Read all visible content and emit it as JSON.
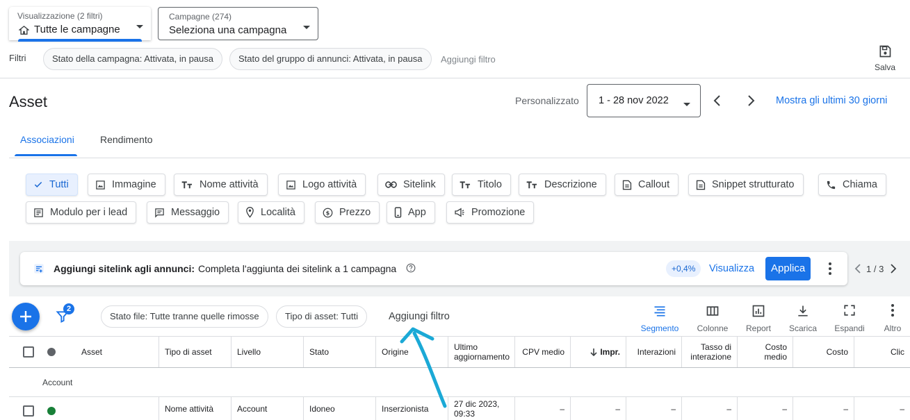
{
  "view_selector": {
    "label": "Visualizzazione (2 filtri)",
    "value": "Tutte le campagne"
  },
  "campaign_selector": {
    "label": "Campagne (274)",
    "value": "Seleziona una campagna"
  },
  "filters": {
    "label": "Filtri",
    "chips": [
      "Stato della campagna: Attivata, in pausa",
      "Stato del gruppo di annunci: Attivata, in pausa"
    ],
    "add_filter": "Aggiungi filtro",
    "save_label": "Salva"
  },
  "page": {
    "title": "Asset",
    "date_mode": "Personalizzato",
    "date_range": "1 - 28 nov 2022",
    "last_30_link": "Mostra gli ultimi 30 giorni"
  },
  "tabs": [
    "Associazioni",
    "Rendimento"
  ],
  "asset_types": {
    "row1": [
      "Tutti",
      "Immagine",
      "Nome attività",
      "Logo attività",
      "Sitelink",
      "Titolo",
      "Descrizione",
      "Callout",
      "Snippet strutturato",
      "Chiama"
    ],
    "row2": [
      "Modulo per i lead",
      "Messaggio",
      "Località",
      "Prezzo",
      "App",
      "Promozione"
    ]
  },
  "banner": {
    "title": "Aggiungi sitelink agli annunci:",
    "text": "Completa l'aggiunta dei sitelink a 1 campagna",
    "uplift": "+0,4%",
    "view_label": "Visualizza",
    "apply_label": "Applica",
    "pager": "1 / 3"
  },
  "table_toolbar": {
    "filter_badge": "2",
    "chips": [
      "Stato file: Tutte tranne quelle rimosse",
      "Tipo di asset: Tutti"
    ],
    "add_filter": "Aggiungi filtro",
    "actions": [
      "Segmento",
      "Colonne",
      "Report",
      "Scarica",
      "Espandi",
      "Altro"
    ]
  },
  "table": {
    "headers": [
      "Asset",
      "Tipo di asset",
      "Livello",
      "Stato",
      "Origine",
      "Ultimo aggiornamento",
      "CPV medio",
      "Impr.",
      "Interazioni",
      "Tasso di interazione",
      "Costo medio",
      "Costo",
      "Clic"
    ],
    "group_label": "Account",
    "row": {
      "tipo": "Nome attività",
      "livello": "Account",
      "stato": "Idoneo",
      "origine": "Inserzionista",
      "aggiornamento": "27 dic 2023, 09:33",
      "metrics": [
        "–",
        "–",
        "–",
        "–",
        "–",
        "–",
        "–"
      ]
    }
  },
  "colors": {
    "accent": "#1a73e8",
    "status_green": "#188038",
    "arrow": "#1ba9d6"
  }
}
